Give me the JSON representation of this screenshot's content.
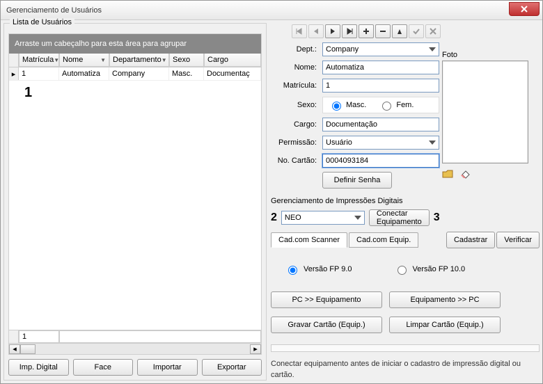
{
  "window": {
    "title": "Gerenciamento de Usuários"
  },
  "left": {
    "legend": "Lista de Usuários",
    "group_hint": "Arraste um cabeçalho para esta área para agrupar",
    "columns": {
      "matricula": "Matrícula",
      "nome": "Nome",
      "departamento": "Departamento",
      "sexo": "Sexo",
      "cargo": "Cargo"
    },
    "row": {
      "matricula": "1",
      "nome": "Automatiza",
      "departamento": "Company",
      "sexo": "Masc.",
      "cargo": "Documentaç"
    },
    "annot1": "1",
    "footer_count": "1",
    "buttons": {
      "imp_digital": "Imp. Digital",
      "face": "Face",
      "importar": "Importar",
      "exportar": "Exportar"
    }
  },
  "form": {
    "labels": {
      "dept": "Dept.:",
      "nome": "Nome:",
      "matricula": "Matrícula:",
      "sexo": "Sexo:",
      "cargo": "Cargo:",
      "permissao": "Permissão:",
      "no_cartao": "No. Cartão:"
    },
    "values": {
      "dept": "Company",
      "nome": "Automatiza",
      "matricula": "1",
      "cargo": "Documentação",
      "permissao": "Usuário",
      "no_cartao": "0004093184"
    },
    "sexo": {
      "masc": "Masc.",
      "fem": "Fem."
    },
    "definir_senha": "Definir Senha",
    "foto_label": "Foto"
  },
  "fingerprint": {
    "title": "Gerenciamento de Impressões Digitais",
    "annot2": "2",
    "device": "NEO",
    "connect": "Conectar Equipamento",
    "annot3": "3",
    "tab1": "Cad.com Scanner",
    "tab2": "Cad.com Equip.",
    "cadastrar": "Cadastrar",
    "verificar": "Verificar",
    "v9": "Versão FP 9.0",
    "v10": "Versão FP 10.0",
    "pc_to_eq": "PC >> Equipamento",
    "eq_to_pc": "Equipamento >> PC",
    "gravar": "Gravar Cartão (Equip.)",
    "limpar": "Limpar Cartão (Equip.)",
    "hint": "Conectar equipamento antes de iniciar o cadastro de impressão digital ou cartão."
  }
}
